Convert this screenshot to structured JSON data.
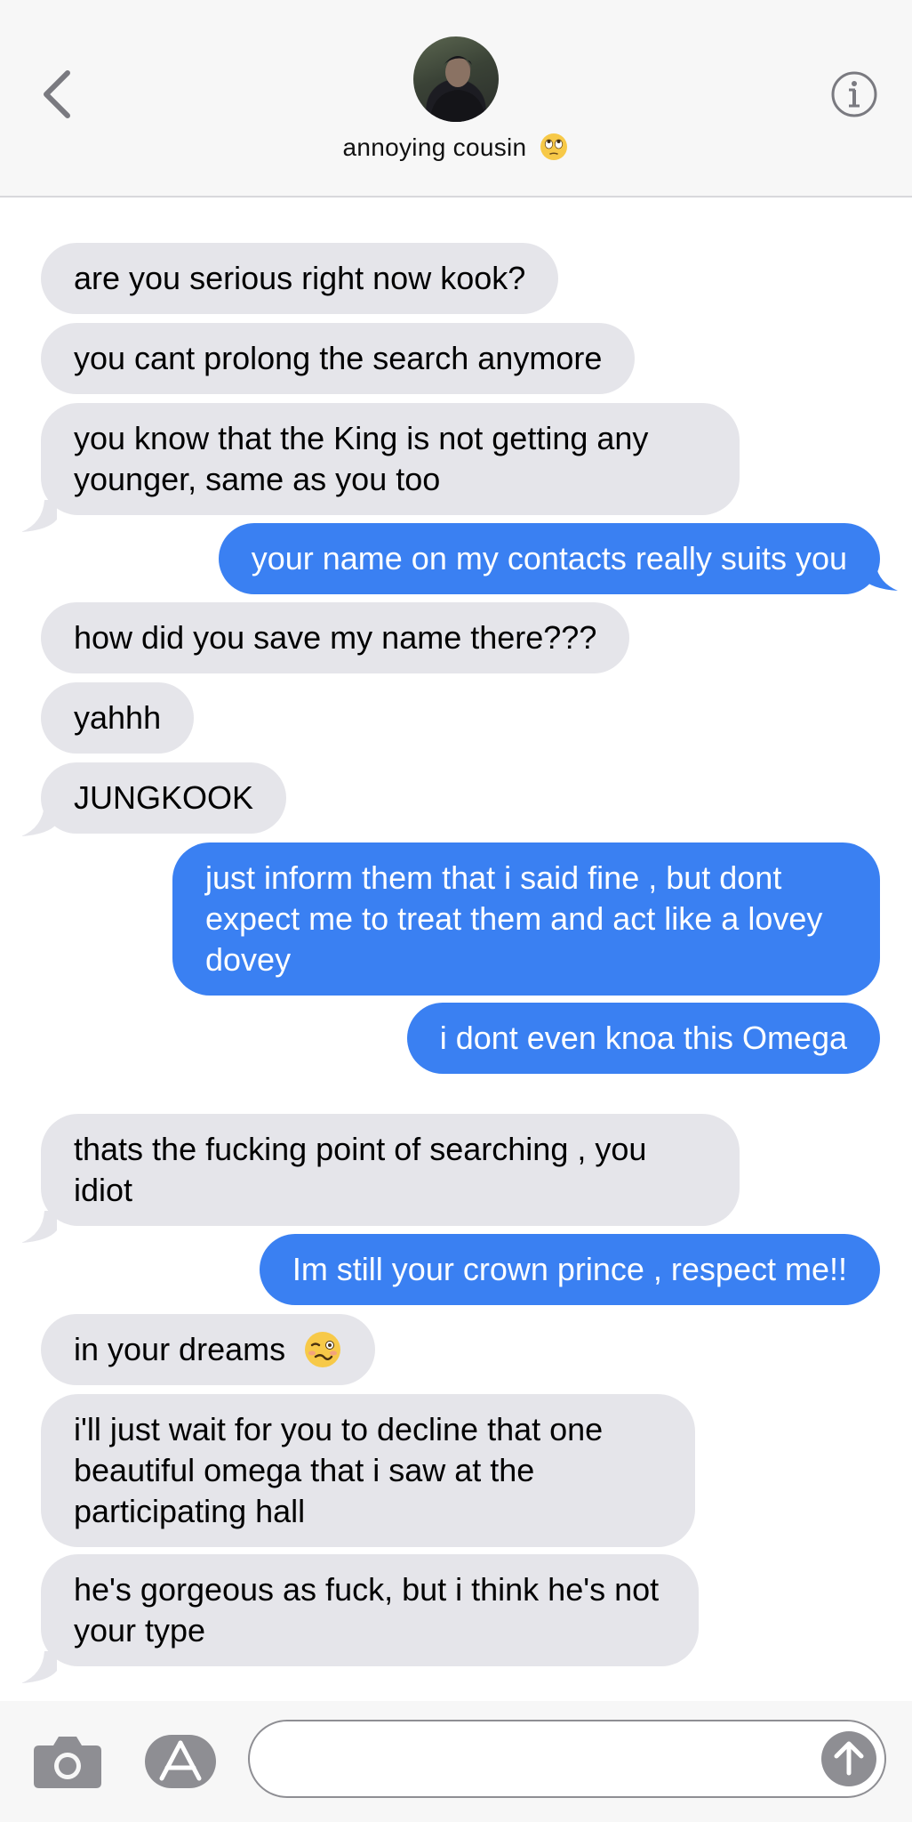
{
  "header": {
    "contact_name": "annoying cousin",
    "contact_emoji": "face-with-rolling-eyes",
    "back_icon": "chevron-left-icon",
    "info_icon": "info-circle-icon"
  },
  "colors": {
    "received_bubble": "#e5e5ea",
    "sent_bubble": "#3a80f2",
    "header_bg": "#f7f7f7"
  },
  "messages": [
    {
      "from": "them",
      "text": "are you serious right now kook?"
    },
    {
      "from": "them",
      "text": "you cant prolong the search anymore"
    },
    {
      "from": "them",
      "text": "you know that the King is not getting any younger, same as you too"
    },
    {
      "from": "me",
      "text": "your name on my contacts really suits you"
    },
    {
      "from": "them",
      "text": "how did you save my name there???"
    },
    {
      "from": "them",
      "text": "yahhh"
    },
    {
      "from": "them",
      "text": "JUNGKOOK"
    },
    {
      "from": "me",
      "text": "just inform them that i said fine , but dont expect me to treat them and act like a lovey dovey"
    },
    {
      "from": "me",
      "text": "i dont even knoa this Omega"
    },
    {
      "from": "them",
      "text": "thats the fucking point of searching , you idiot"
    },
    {
      "from": "me",
      "text": "Im still your crown prince , respect me!!"
    },
    {
      "from": "them",
      "text": "in your dreams",
      "emoji": "woozy-face"
    },
    {
      "from": "them",
      "text": "i'll just wait for you to decline that one beautiful omega that i saw at the participating hall"
    },
    {
      "from": "them",
      "text": "he's gorgeous as fuck, but i think he's not your type"
    }
  ],
  "composer": {
    "camera_icon": "camera-icon",
    "apps_icon": "app-store-icon",
    "send_icon": "send-arrow-up-icon",
    "placeholder": ""
  }
}
